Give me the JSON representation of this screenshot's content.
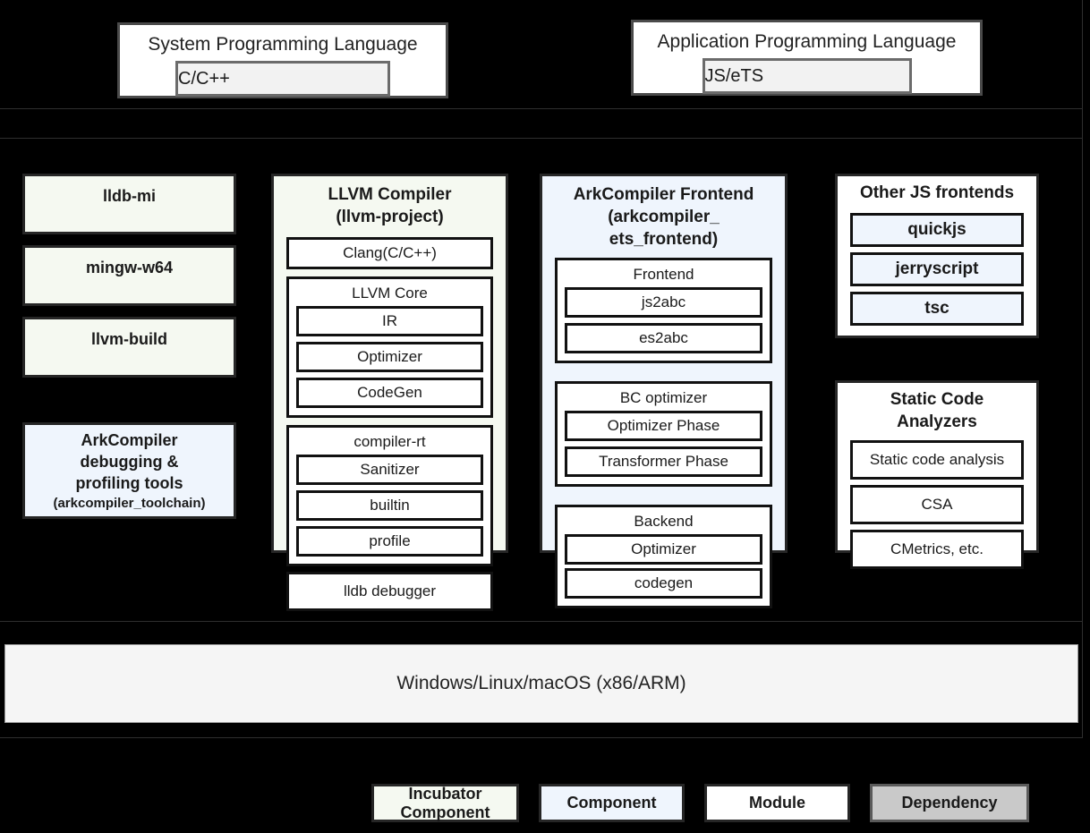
{
  "languages": [
    {
      "title": "System Programming Language",
      "chip": "C/C++"
    },
    {
      "title": "Application Programming Language",
      "chip": "JS/eTS"
    }
  ],
  "left_column": {
    "incubators": [
      {
        "label": "lldb-mi"
      },
      {
        "label": "mingw-w64"
      },
      {
        "label": "llvm-build"
      }
    ],
    "component": {
      "line1": "ArkCompiler",
      "line2": "debugging &",
      "line3": "profiling tools",
      "line4": "(arkcompiler_toolchain)"
    }
  },
  "llvm": {
    "title_line1": "LLVM Compiler",
    "title_line2": "(llvm-project)",
    "clang": "Clang(C/C++)",
    "core": {
      "title": "LLVM Core",
      "items": [
        "IR",
        "Optimizer",
        "CodeGen"
      ]
    },
    "compiler_rt": {
      "title": "compiler-rt",
      "items": [
        "Sanitizer",
        "builtin",
        "profile"
      ]
    },
    "lldb": "lldb debugger"
  },
  "ark": {
    "title_line1": "ArkCompiler Frontend",
    "title_line2": "(arkcompiler_",
    "title_line3": "ets_frontend)",
    "frontend": {
      "title": "Frontend",
      "items": [
        "js2abc",
        "es2abc"
      ]
    },
    "bc_optimizer": {
      "title": "BC optimizer",
      "items": [
        "Optimizer Phase",
        "Transformer Phase"
      ]
    },
    "backend": {
      "title": "Backend",
      "items": [
        "Optimizer",
        "codegen"
      ]
    }
  },
  "other_js": {
    "title": "Other JS frontends",
    "items": [
      "quickjs",
      "jerryscript",
      "tsc"
    ]
  },
  "analyzers": {
    "title_line1": "Static Code",
    "title_line2": "Analyzers",
    "items": [
      "Static code analysis",
      "CSA",
      "CMetrics, etc."
    ]
  },
  "os_bar": {
    "label": "Windows/Linux/macOS (x86/ARM)"
  },
  "legend": [
    {
      "line1": "Incubator",
      "line2": "Component"
    },
    {
      "line1": "Component",
      "line2": ""
    },
    {
      "line1": "Module",
      "line2": ""
    },
    {
      "line1": "Dependency",
      "line2": ""
    }
  ],
  "colors": {
    "incubator": "#f5f9f1",
    "component": "#eff5fd",
    "module": "#ffffff",
    "dependency": "#c9c9c9",
    "background": "#000000",
    "border": "#262626"
  }
}
